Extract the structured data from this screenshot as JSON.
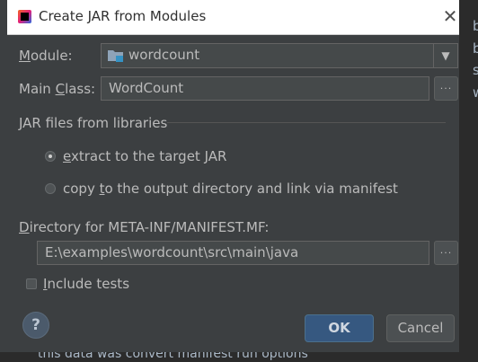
{
  "dialog": {
    "title": "Create JAR from Modules",
    "close_glyph": "✕",
    "app_icon": "intellij-idea-icon"
  },
  "module": {
    "label_mnemonic": "M",
    "label_rest": "odule:",
    "value": "wordcount",
    "icon": "module-folder-icon"
  },
  "main_class": {
    "label_pre": "Main ",
    "label_mnemonic": "C",
    "label_post": "lass:",
    "value": "WordCount",
    "browse": "..."
  },
  "jar_libraries": {
    "group_title": "JAR files from libraries",
    "options": [
      {
        "mnemonic": "e",
        "rest": "xtract to the target JAR",
        "selected": true
      },
      {
        "pre": "copy ",
        "mnemonic": "t",
        "rest": "o the output directory and link via manifest",
        "selected": false
      }
    ]
  },
  "manifest_dir": {
    "label_mnemonic": "D",
    "label_rest": "irectory for META-INF/MANIFEST.MF:",
    "value": "E:\\examples\\wordcount\\src\\main\\java",
    "browse": "..."
  },
  "include_tests": {
    "mnemonic": "I",
    "rest": "nclude tests",
    "checked": false
  },
  "buttons": {
    "help": "?",
    "ok": "OK",
    "cancel": "Cancel"
  },
  "background": {
    "side_chars": [
      "b",
      "b",
      "s",
      "w"
    ],
    "bottom_text": "this data was convert manifest run options"
  },
  "colors": {
    "dialog_bg": "#3c3f41",
    "field_bg": "#45494a",
    "ok_bg": "#365880",
    "text": "#bbbbbb"
  }
}
